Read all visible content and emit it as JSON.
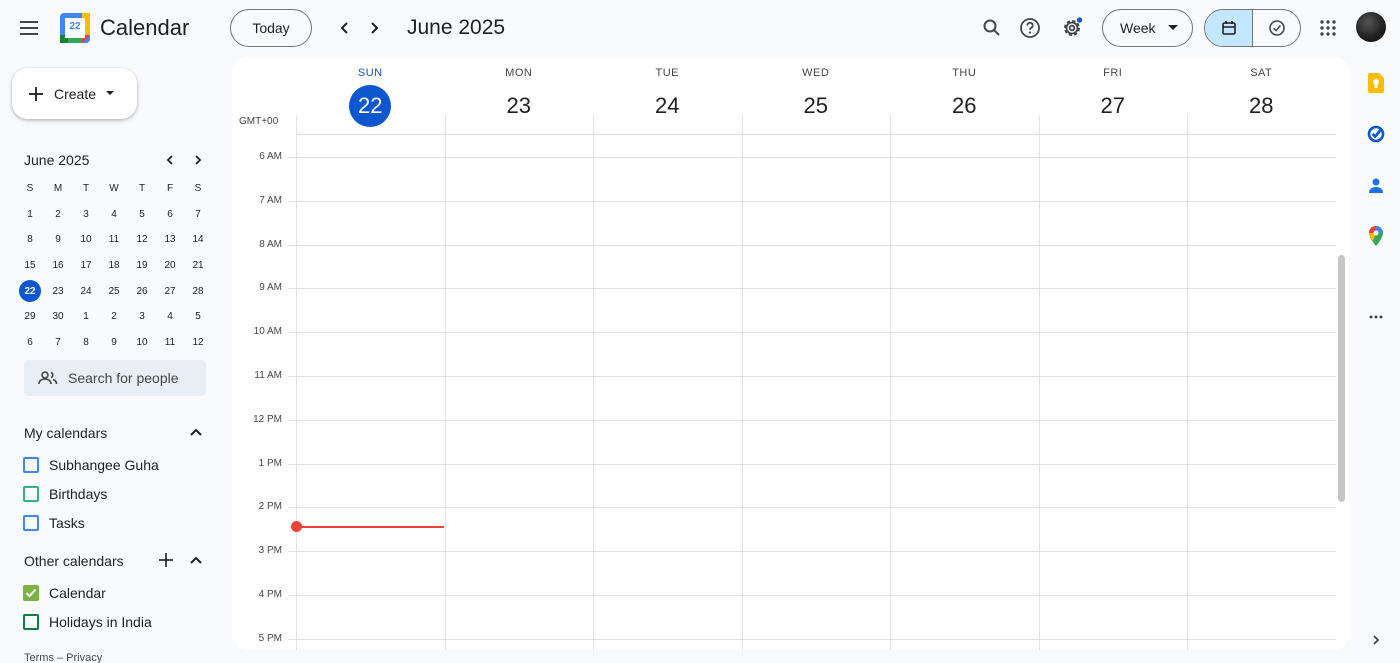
{
  "header": {
    "app_title": "Calendar",
    "logo_day": "22",
    "today_label": "Today",
    "period_label": "June 2025",
    "view_label": "Week",
    "icons": [
      "menu-icon",
      "search-icon",
      "help-icon",
      "settings-icon",
      "calendar-view-icon",
      "tasks-view-icon",
      "apps-grid-icon"
    ]
  },
  "sidebar": {
    "create_label": "Create",
    "mini_calendar": {
      "title": "June 2025",
      "weekdays": [
        "S",
        "M",
        "T",
        "W",
        "T",
        "F",
        "S"
      ],
      "weeks": [
        [
          "1",
          "2",
          "3",
          "4",
          "5",
          "6",
          "7"
        ],
        [
          "8",
          "9",
          "10",
          "11",
          "12",
          "13",
          "14"
        ],
        [
          "15",
          "16",
          "17",
          "18",
          "19",
          "20",
          "21"
        ],
        [
          "22",
          "23",
          "24",
          "25",
          "26",
          "27",
          "28"
        ],
        [
          "29",
          "30",
          "1",
          "2",
          "3",
          "4",
          "5"
        ],
        [
          "6",
          "7",
          "8",
          "9",
          "10",
          "11",
          "12"
        ]
      ],
      "today": "22"
    },
    "search_people_placeholder": "Search for people",
    "my_calendars": {
      "title": "My calendars",
      "items": [
        {
          "label": "Subhangee Guha",
          "color": "#4285f4",
          "checked": false
        },
        {
          "label": "Birthdays",
          "color": "#33b679",
          "checked": false
        },
        {
          "label": "Tasks",
          "color": "#4285f4",
          "checked": false
        }
      ]
    },
    "other_calendars": {
      "title": "Other calendars",
      "items": [
        {
          "label": "Calendar",
          "color": "#7cb342",
          "checked": true
        },
        {
          "label": "Holidays in India",
          "color": "#0b8043",
          "checked": false
        }
      ]
    },
    "footer": "Terms – Privacy"
  },
  "main": {
    "timezone": "GMT+00",
    "days": [
      {
        "dow": "SUN",
        "num": "22",
        "today": true
      },
      {
        "dow": "MON",
        "num": "23",
        "today": false
      },
      {
        "dow": "TUE",
        "num": "24",
        "today": false
      },
      {
        "dow": "WED",
        "num": "25",
        "today": false
      },
      {
        "dow": "THU",
        "num": "26",
        "today": false
      },
      {
        "dow": "FRI",
        "num": "27",
        "today": false
      },
      {
        "dow": "SAT",
        "num": "28",
        "today": false
      }
    ],
    "hours": [
      "6 AM",
      "7 AM",
      "8 AM",
      "9 AM",
      "10 AM",
      "11 AM",
      "12 PM",
      "1 PM",
      "2 PM",
      "3 PM",
      "4 PM",
      "5 PM"
    ]
  },
  "right_rail": {
    "icons": [
      "keep-icon",
      "tasks-icon",
      "contacts-icon",
      "maps-icon",
      "more-icon",
      "expand-chevron-icon"
    ]
  },
  "colors": {
    "accent": "#0b57d0",
    "current_time": "#ea4335",
    "selected_view": "#c2e7ff"
  }
}
